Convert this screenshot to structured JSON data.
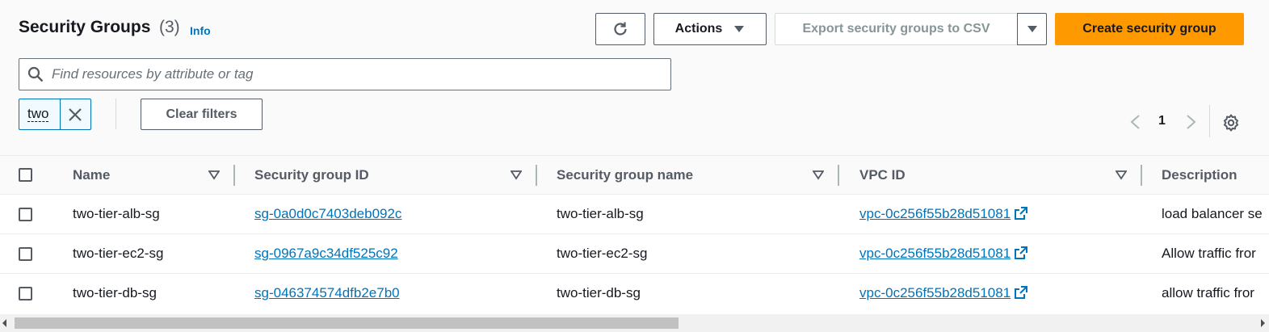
{
  "header": {
    "title": "Security Groups",
    "count": "(3)",
    "info": "Info"
  },
  "toolbar": {
    "actions_label": "Actions",
    "export_label": "Export security groups to CSV",
    "create_label": "Create security group"
  },
  "search": {
    "placeholder": "Find resources by attribute or tag",
    "value": ""
  },
  "filters": {
    "token": "two",
    "clear_label": "Clear filters"
  },
  "pagination": {
    "current_page": "1"
  },
  "table": {
    "columns": [
      "Name",
      "Security group ID",
      "Security group name",
      "VPC ID",
      "Description"
    ],
    "rows": [
      {
        "name": "two-tier-alb-sg",
        "group_id": "sg-0a0d0c7403deb092c",
        "group_name": "two-tier-alb-sg",
        "vpc_id": "vpc-0c256f55b28d51081",
        "description": "load balancer se"
      },
      {
        "name": "two-tier-ec2-sg",
        "group_id": "sg-0967a9c34df525c92",
        "group_name": "two-tier-ec2-sg",
        "vpc_id": "vpc-0c256f55b28d51081",
        "description": "Allow traffic fror"
      },
      {
        "name": "two-tier-db-sg",
        "group_id": "sg-046374574dfb2e7b0",
        "group_name": "two-tier-db-sg",
        "vpc_id": "vpc-0c256f55b28d51081",
        "description": "allow traffic fror"
      }
    ]
  },
  "icons": {
    "refresh": "refresh-icon",
    "actions_caret": "caret-down-icon",
    "search": "search-icon",
    "close": "close-icon",
    "prev": "chevron-left-icon",
    "next": "chevron-right-icon",
    "settings": "gear-icon",
    "sort": "sort-caret-icon",
    "external": "external-link-icon"
  },
  "colors": {
    "accent": "#ff9900",
    "link": "#0073bb",
    "text": "#16191f",
    "muted": "#545b64"
  }
}
